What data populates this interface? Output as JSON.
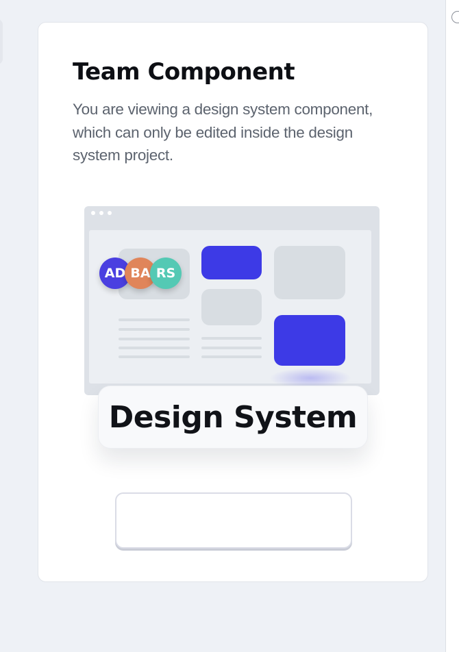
{
  "dialog": {
    "title": "Team Component",
    "description": "You are viewing a design system component, which can only be edited inside the design system project.",
    "illustration": {
      "avatars": [
        {
          "initials": "AD",
          "color": "#4a3fe0"
        },
        {
          "initials": "BA",
          "color": "#e0855a"
        },
        {
          "initials": "RS",
          "color": "#54c9b4"
        }
      ],
      "label": "Design System"
    },
    "button_label": ""
  },
  "colors": {
    "accent_blue": "#3d3ae6",
    "placeholder_gray": "#d8dde2",
    "background": "#eef1f6"
  }
}
